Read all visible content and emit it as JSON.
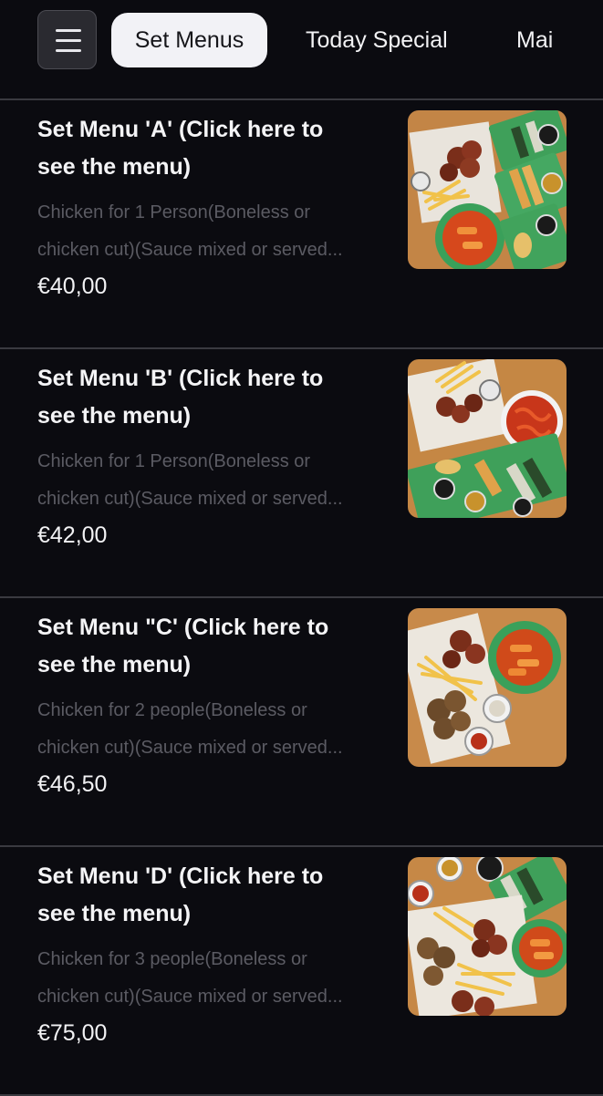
{
  "header": {
    "menu_icon": "hamburger-menu-icon",
    "tabs": [
      {
        "label": "Set Menus",
        "active": true
      },
      {
        "label": "Today Special",
        "active": false
      },
      {
        "label": "Mai",
        "active": false
      }
    ]
  },
  "items": [
    {
      "title_line1": "Set Menu 'A' (Click here to",
      "title_line2": "see the menu)",
      "desc_line1": "Chicken for 1 Person(Boneless or",
      "desc_line2": "chicken cut)(Sauce mixed or served...",
      "price": "€40,00",
      "image": "food-photo-set-a"
    },
    {
      "title_line1": "Set Menu 'B' (Click here to",
      "title_line2": "see the menu)",
      "desc_line1": "Chicken for 1 Person(Boneless or",
      "desc_line2": "chicken cut)(Sauce mixed or served...",
      "price": "€42,00",
      "image": "food-photo-set-b"
    },
    {
      "title_line1": "Set Menu \"C' (Click here to",
      "title_line2": "see the menu)",
      "desc_line1": "Chicken for 2 people(Boneless or",
      "desc_line2": "chicken cut)(Sauce mixed or served...",
      "price": "€46,50",
      "image": "food-photo-set-c"
    },
    {
      "title_line1": "Set Menu 'D' (Click here to",
      "title_line2": "see the menu)",
      "desc_line1": "Chicken for 3 people(Boneless or",
      "desc_line2": "chicken cut)(Sauce mixed or served...",
      "price": "€75,00",
      "image": "food-photo-set-d"
    }
  ],
  "colors": {
    "background": "#0b0b10",
    "active_tab_bg": "#f2f2f6",
    "muted_text": "#5b5b63",
    "divider": "#3a3a40"
  }
}
